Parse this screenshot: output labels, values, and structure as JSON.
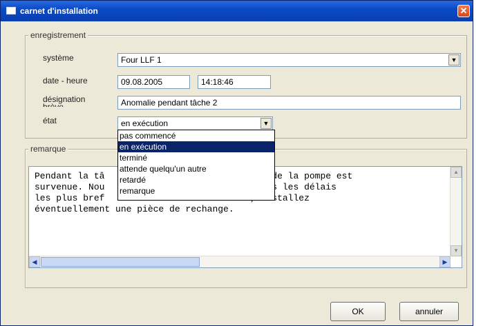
{
  "window": {
    "title": "carnet d'installation",
    "close_symbol": "✕"
  },
  "recording": {
    "legend": "enregistrement",
    "system_label": "système",
    "system_value": "Four LLF 1",
    "datetime_label": "date - heure",
    "date_value": "09.08.2005",
    "time_value": "14:18:46",
    "designation_label": "désignation",
    "designation_label_cut": "brève",
    "designation_value": "Anomalie pendant tâche 2",
    "state_label": "état",
    "state_value": "en exécution",
    "state_options": [
      "pas commencé",
      "en exécution",
      "terminé",
      "attende quelqu'un autre",
      "retardé",
      "remarque"
    ],
    "state_selected_index": 1
  },
  "remark": {
    "legend": "remarque",
    "line1": "Pendant la tâ",
    "line1b": "la zone de la pompe est",
    "line2": "survenue. Nou",
    "line2b": "fier dans les délais",
    "line3": "les plus bref",
    "line3b": "h, installez",
    "line4": "éventuellement une pièce de rechange."
  },
  "buttons": {
    "ok": "OK",
    "cancel": "annuler"
  }
}
